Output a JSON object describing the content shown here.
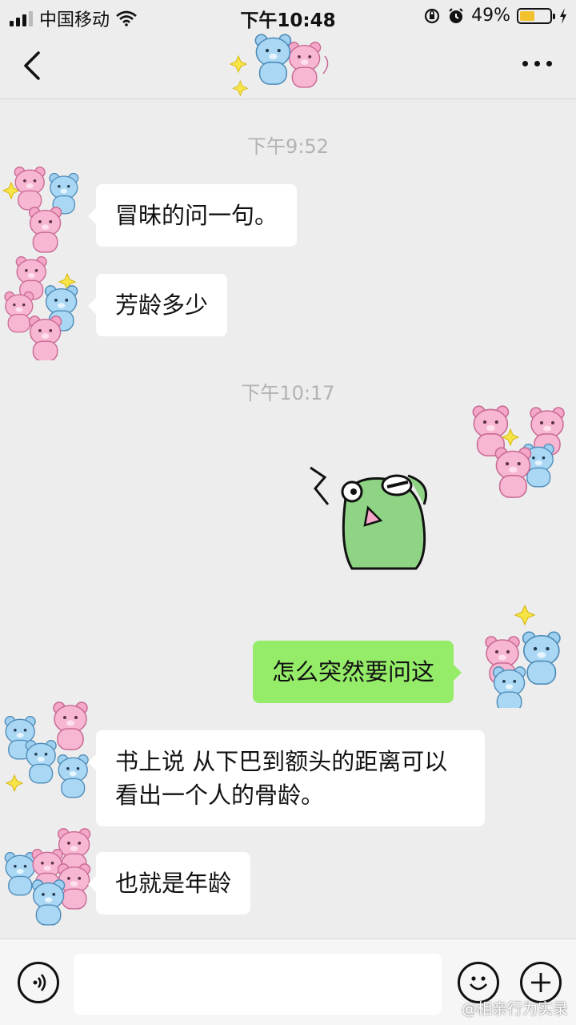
{
  "status_bar": {
    "carrier": "中国移动",
    "time": "下午10:48",
    "battery_percent": "49%",
    "battery_level": 0.49,
    "icons": [
      "signal-icon",
      "wifi-icon",
      "rotation-lock-icon",
      "alarm-icon",
      "battery-icon",
      "charging-icon"
    ]
  },
  "nav": {
    "back_icon": "chevron-left-icon",
    "more_icon": "more-dots-icon",
    "title_sticker": "bear-sticker"
  },
  "messages": [
    {
      "type": "timestamp",
      "text": "下午9:52"
    },
    {
      "type": "incoming",
      "text": "冒昧的问一句。"
    },
    {
      "type": "incoming",
      "text": "芳龄多少"
    },
    {
      "type": "timestamp",
      "text": "下午10:17"
    },
    {
      "type": "outgoing-sticker",
      "sticker": "frog-sticker"
    },
    {
      "type": "outgoing",
      "text": "怎么突然要问这"
    },
    {
      "type": "incoming",
      "text": "书上说 从下巴到额头的距离可以看出一个人的骨龄。"
    },
    {
      "type": "incoming",
      "text": "也就是年龄"
    }
  ],
  "input_bar": {
    "voice_icon": "voice-icon",
    "emoji_icon": "emoji-icon",
    "plus_icon": "plus-icon"
  },
  "watermark": "@相亲行为实录",
  "colors": {
    "background": "#ededed",
    "outgoing_bubble": "#95ec69",
    "incoming_bubble": "#ffffff",
    "timestamp": "#b2b2b2",
    "battery": "#f2c12e"
  }
}
